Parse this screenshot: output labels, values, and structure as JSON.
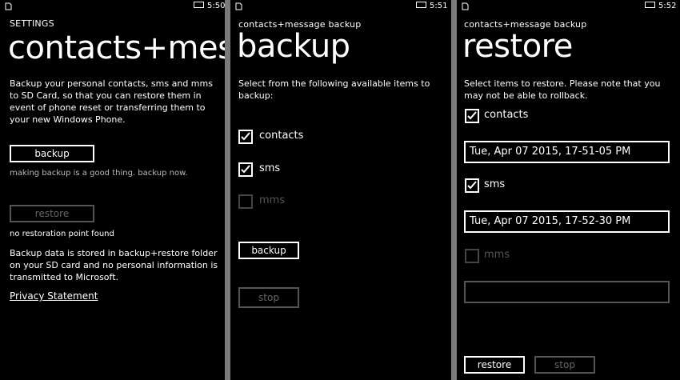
{
  "panel1": {
    "time": "5:50",
    "header": "SETTINGS",
    "title": "contacts+mess",
    "description": "Backup your personal contacts, sms and mms to SD Card, so that you can restore them in event of phone reset or transferring them to your new Windows Phone.",
    "backup_label": "backup",
    "backup_hint": "making backup is a good thing. backup now.",
    "restore_label": "restore",
    "restore_hint": "no restoration point found",
    "info": "Backup data is stored in backup+restore folder on your SD card and no personal information is transmitted to Microsoft.",
    "privacy_link": "Privacy Statement"
  },
  "panel2": {
    "time": "5:51",
    "header": "contacts+message backup",
    "title": "backup",
    "instruction": "Select from the following available items to backup:",
    "items": [
      {
        "label": "contacts",
        "checked": true,
        "enabled": true
      },
      {
        "label": "sms",
        "checked": true,
        "enabled": true
      },
      {
        "label": "mms",
        "checked": false,
        "enabled": false
      }
    ],
    "backup_label": "backup",
    "stop_label": "stop"
  },
  "panel3": {
    "time": "5:52",
    "header": "contacts+message backup",
    "title": "restore",
    "instruction": "Select items to restore. Please note that you may not be able to rollback.",
    "contacts_label": "contacts",
    "contacts_point": "Tue, Apr 07 2015, 17-51-05 PM",
    "sms_label": "sms",
    "sms_point": "Tue, Apr 07 2015, 17-52-30 PM",
    "mms_label": "mms",
    "mms_point": "",
    "restore_label": "restore",
    "stop_label": "stop"
  }
}
